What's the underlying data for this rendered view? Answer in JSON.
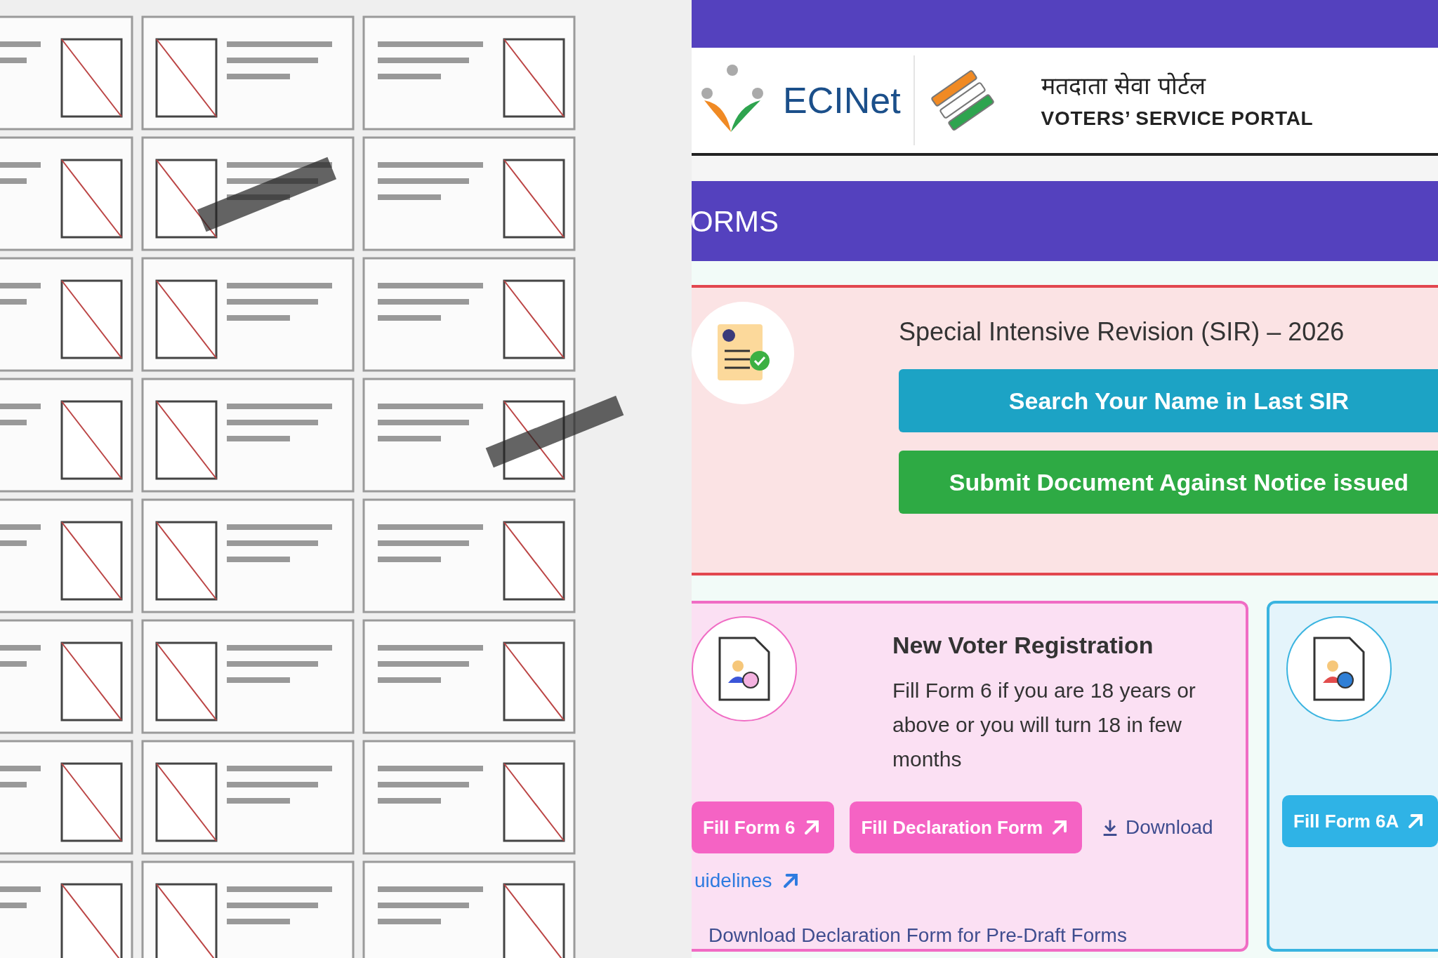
{
  "header": {
    "logo_text": "ECINet",
    "portal_title_hindi": "मतदाता सेवा पोर्टल",
    "portal_title": "VOTERS’ SERVICE PORTAL"
  },
  "section_banner": {
    "title": "ORMS"
  },
  "sir_panel": {
    "title": "Special Intensive Revision (SIR) – 2026",
    "buttons": [
      {
        "label": "Search Your Name in Last SIR",
        "kind": "primary"
      },
      {
        "label": "Submit Document Against Notice issued",
        "kind": "success"
      }
    ]
  },
  "cards": [
    {
      "kind": "pink",
      "title": "New Voter Registration",
      "description": "Fill Form 6 if you are 18 years or above or you will turn 18 in few months",
      "buttons": [
        "Fill Form 6",
        "Fill Declaration Form"
      ],
      "download_link": "Download",
      "guidelines_link": "uidelines",
      "declaration_link": "Download Declaration Form for Pre-Draft Forms"
    },
    {
      "kind": "blue",
      "buttons": [
        "Fill Form 6A"
      ]
    }
  ]
}
